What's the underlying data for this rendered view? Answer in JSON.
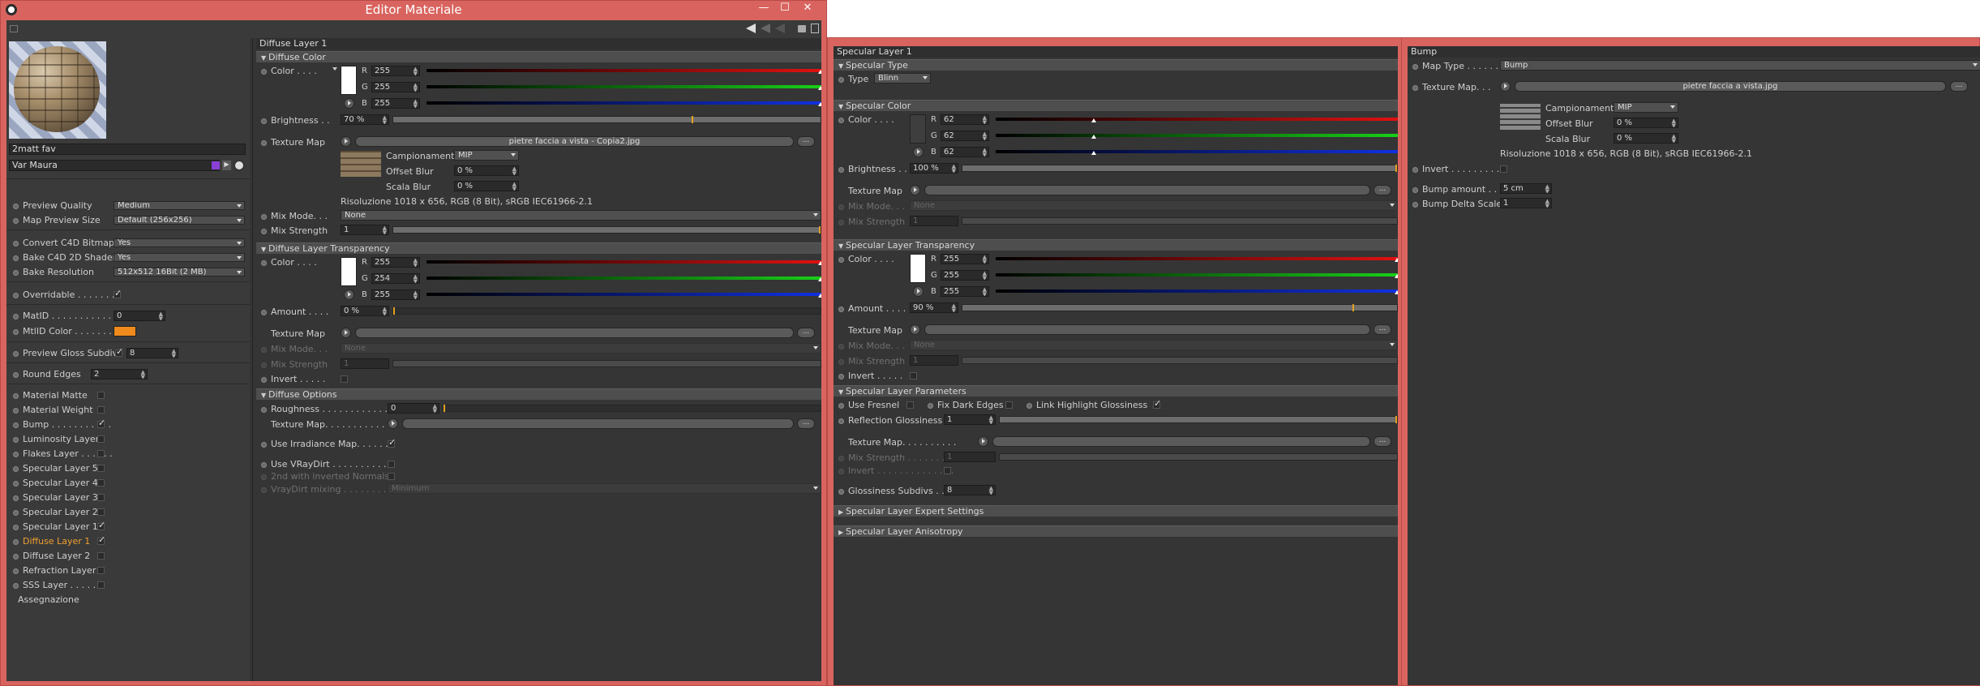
{
  "window": {
    "title": "Editor Materiale"
  },
  "sidebar": {
    "material_name": "2matt fav",
    "material_var": "Var Maura",
    "settings": [
      {
        "label": "Preview Quality",
        "value": "Medium"
      },
      {
        "label": "Map Preview Size",
        "value": "Default (256x256)"
      },
      {
        "label": "Convert C4D Bitmaps",
        "value": "Yes"
      },
      {
        "label": "Bake C4D 2D Shaders",
        "value": "Yes"
      },
      {
        "label": "Bake Resolution",
        "value": "512x512  16Bit  (2 MB)"
      }
    ],
    "overridable_label": "Overridable . . . . . . .",
    "matid_label": "MatID . . . . . . . . . . . . .",
    "matid_value": "0",
    "mtlid_color_label": "MtlID Color . . . . . . .",
    "preview_gloss_label": "Preview Gloss Subdivs",
    "preview_gloss_value": "8",
    "round_edges_label": "Round Edges",
    "round_edges_value": "2",
    "layers": [
      {
        "label": "Material Matte",
        "checked": false,
        "active": false
      },
      {
        "label": "Material Weight",
        "checked": false,
        "active": false
      },
      {
        "label": "Bump . . . . . . . . . . .",
        "checked": true,
        "active": false
      },
      {
        "label": "Luminosity Layer",
        "checked": false,
        "active": false
      },
      {
        "label": "Flakes Layer . . . . . .",
        "checked": false,
        "active": false
      },
      {
        "label": "Specular Layer 5",
        "checked": false,
        "active": false
      },
      {
        "label": "Specular Layer 4",
        "checked": false,
        "active": false
      },
      {
        "label": "Specular Layer 3",
        "checked": false,
        "active": false
      },
      {
        "label": "Specular Layer 2",
        "checked": false,
        "active": false
      },
      {
        "label": "Specular Layer 1",
        "checked": true,
        "active": false
      },
      {
        "label": "Diffuse Layer 1",
        "checked": true,
        "active": true
      },
      {
        "label": "Diffuse Layer 2",
        "checked": false,
        "active": false
      },
      {
        "label": "Refraction Layer",
        "checked": false,
        "active": false
      },
      {
        "label": "SSS Layer . . . . . .",
        "checked": false,
        "active": false
      }
    ],
    "assignment": "Assegnazione"
  },
  "diffuse": {
    "panel_title": "Diffuse Layer 1",
    "color_section": "Diffuse Color",
    "color_label": "Color . . . .",
    "r": "255",
    "g": "255",
    "b": "255",
    "brightness_label": "Brightness . .",
    "brightness_value": "70 %",
    "brightness_level": 0.7,
    "texture_map_label": "Texture Map",
    "texture_file": "pietre faccia a vista - Copia2.jpg",
    "sampling_label": "Campionamento",
    "sampling_value": "MIP",
    "offset_blur_label": "Offset Blur",
    "offset_blur_value": "0 %",
    "scale_blur_label": "Scala Blur",
    "scale_blur_value": "0 %",
    "resolution": "Risoluzione 1018 x 656, RGB (8 Bit), sRGB IEC61966-2.1",
    "mix_mode_label": "Mix Mode. . .",
    "mix_mode_value": "None",
    "mix_strength_label": "Mix Strength",
    "mix_strength_value": "1",
    "transparency_section": "Diffuse Layer Transparency",
    "t_color_label": "Color . . . .",
    "t_r": "255",
    "t_g": "254",
    "t_b": "255",
    "amount_label": "Amount . . . .",
    "amount_value": "0 %",
    "t_texture_label": "Texture Map",
    "t_mix_mode_label": "Mix Mode. . .",
    "t_mix_mode_value": "None",
    "t_mix_strength_label": "Mix Strength",
    "t_mix_strength_value": "1",
    "invert_label": "Invert . . . . .",
    "options_section": "Diffuse Options",
    "roughness_label": "Roughness . . . . . . . . . . . .",
    "roughness_value": "0",
    "o_texture_label": "Texture Map. . . . . . . . . . .",
    "irradiance_label": "Use Irradiance Map. . . . . . .",
    "vraydirt_label": "Use VRayDirt . . . . . . . . . .",
    "inverted_normals_label": "2nd with inverted Normals",
    "vraydirt_mixing_label": "VrayDirt mixing . . . . . . . .",
    "vraydirt_mixing_value": "Minimum"
  },
  "specular": {
    "panel_title": "Specular Layer 1",
    "type_section": "Specular Type",
    "type_label": "Type",
    "type_value": "Blinn",
    "color_section": "Specular Color",
    "color_label": "Color . . . .",
    "r": "62",
    "g": "62",
    "b": "62",
    "brightness_label": "Brightness . .",
    "brightness_value": "100 %",
    "brightness_level": 1.0,
    "texture_map_label": "Texture Map",
    "mix_mode_label": "Mix Mode. . .",
    "mix_mode_value": "None",
    "mix_strength_label": "Mix Strength",
    "mix_strength_value": "1",
    "transparency_section": "Specular Layer Transparency",
    "t_color_label": "Color . . . .",
    "t_r": "255",
    "t_g": "255",
    "t_b": "255",
    "amount_label": "Amount . . . .",
    "amount_value": "90 %",
    "amount_level": 0.9,
    "t_texture_label": "Texture Map",
    "t_mix_mode_label": "Mix Mode. . .",
    "t_mix_mode_value": "None",
    "t_mix_strength_label": "Mix Strength",
    "t_mix_strength_value": "1",
    "invert_label": "Invert . . . . .",
    "params_section": "Specular Layer Parameters",
    "use_fresnel_label": "Use Fresnel",
    "fix_dark_label": "Fix Dark Edges",
    "link_gloss_label": "Link Highlight Glossiness",
    "refl_gloss_label": "Reflection Glossiness",
    "refl_gloss_value": "1",
    "p_texture_label": "Texture Map. . . . . . . . . .",
    "p_mix_strength_label": "Mix Strength . . . . . . . . .",
    "p_mix_strength_value": "1",
    "p_invert_label": "Invert . . . . . . . . . . . . . .",
    "gloss_subdivs_label": "Glossiness Subdivs . . .",
    "gloss_subdivs_value": "8",
    "expert_section": "Specular Layer Expert Settings",
    "aniso_section": "Specular Layer Anisotropy"
  },
  "bump": {
    "panel_title": "Bump",
    "map_type_label": "Map Type . . . . . . .",
    "map_type_value": "Bump",
    "texture_map_label": "Texture Map. . .",
    "texture_file": "pietre faccia a vista.jpg",
    "sampling_label": "Campionamento",
    "sampling_value": "MIP",
    "offset_blur_label": "Offset Blur",
    "offset_blur_value": "0 %",
    "scale_blur_label": "Scala Blur",
    "scale_blur_value": "0 %",
    "resolution": "Risoluzione 1018 x 656, RGB (8 Bit), sRGB IEC61966-2.1",
    "invert_label": "Invert . . . . . . . . . .",
    "bump_amount_label": "Bump amount . . .",
    "bump_amount_value": "5 cm",
    "bump_delta_label": "Bump Delta Scale",
    "bump_delta_value": "1"
  },
  "colors": {
    "frame": "#d9645f",
    "panel": "#353535",
    "accent": "#e2a020",
    "mtlid": "#f08a1c",
    "active_layer": "#f0a030"
  }
}
